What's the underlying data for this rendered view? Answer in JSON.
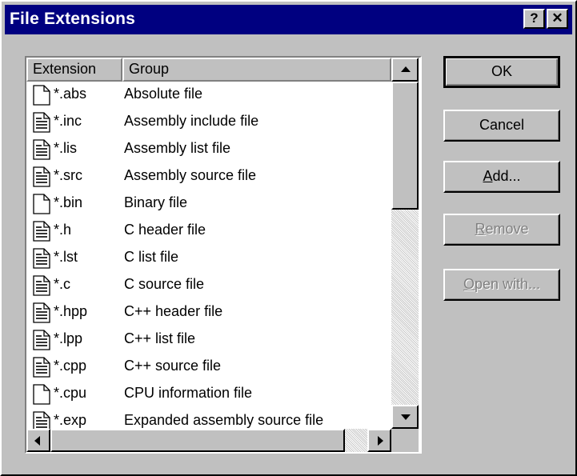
{
  "window": {
    "title": "File Extensions",
    "help_label": "?",
    "close_label": "✕"
  },
  "list": {
    "columns": [
      "Extension",
      "Group"
    ],
    "rows": [
      {
        "ext": "*.abs",
        "group": "Absolute file",
        "icon": "blank-file-icon"
      },
      {
        "ext": "*.inc",
        "group": "Assembly include file",
        "icon": "text-file-icon"
      },
      {
        "ext": "*.lis",
        "group": "Assembly list file",
        "icon": "text-file-icon"
      },
      {
        "ext": "*.src",
        "group": "Assembly source file",
        "icon": "text-file-icon"
      },
      {
        "ext": "*.bin",
        "group": "Binary file",
        "icon": "blank-file-icon"
      },
      {
        "ext": "*.h",
        "group": "C header file",
        "icon": "text-file-icon"
      },
      {
        "ext": "*.lst",
        "group": "C list file",
        "icon": "text-file-icon"
      },
      {
        "ext": "*.c",
        "group": "C source file",
        "icon": "text-file-icon"
      },
      {
        "ext": "*.hpp",
        "group": "C++ header file",
        "icon": "text-file-icon"
      },
      {
        "ext": "*.lpp",
        "group": "C++ list file",
        "icon": "text-file-icon"
      },
      {
        "ext": "*.cpp",
        "group": "C++ source file",
        "icon": "text-file-icon"
      },
      {
        "ext": "*.cpu",
        "group": "CPU information file",
        "icon": "blank-file-icon"
      },
      {
        "ext": "*.exp",
        "group": "Expanded assembly source file",
        "icon": "text-file-icon"
      }
    ]
  },
  "buttons": {
    "ok": {
      "pre": "",
      "key": "",
      "post": "OK",
      "enabled": true
    },
    "cancel": {
      "pre": "",
      "key": "",
      "post": "Cancel",
      "enabled": true
    },
    "add": {
      "pre": "",
      "key": "A",
      "post": "dd...",
      "enabled": true
    },
    "remove": {
      "pre": "",
      "key": "R",
      "post": "emove",
      "enabled": false
    },
    "open_with": {
      "pre": "",
      "key": "O",
      "post": "pen with...",
      "enabled": false
    }
  },
  "colors": {
    "title_bar": "#000080",
    "face": "#c0c0c0",
    "disabled_text": "#808080"
  }
}
